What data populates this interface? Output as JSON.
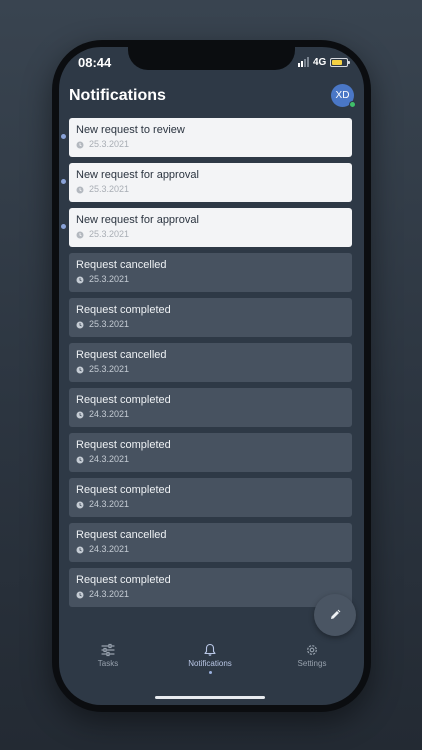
{
  "status_bar": {
    "time": "08:44",
    "network": "4G"
  },
  "header": {
    "title": "Notifications",
    "avatar_initials": "XD"
  },
  "notifications": [
    {
      "title": "New request to review",
      "date": "25.3.2021",
      "unread": true
    },
    {
      "title": "New request for approval",
      "date": "25.3.2021",
      "unread": true
    },
    {
      "title": "New request for approval",
      "date": "25.3.2021",
      "unread": true
    },
    {
      "title": "Request cancelled",
      "date": "25.3.2021",
      "unread": false
    },
    {
      "title": "Request completed",
      "date": "25.3.2021",
      "unread": false
    },
    {
      "title": "Request cancelled",
      "date": "25.3.2021",
      "unread": false
    },
    {
      "title": "Request completed",
      "date": "24.3.2021",
      "unread": false
    },
    {
      "title": "Request completed",
      "date": "24.3.2021",
      "unread": false
    },
    {
      "title": "Request completed",
      "date": "24.3.2021",
      "unread": false
    },
    {
      "title": "Request cancelled",
      "date": "24.3.2021",
      "unread": false
    },
    {
      "title": "Request completed",
      "date": "24.3.2021",
      "unread": false
    }
  ],
  "tabbar": {
    "tabs": [
      {
        "label": "Tasks",
        "icon": "sliders-icon",
        "active": false
      },
      {
        "label": "Notifications",
        "icon": "bell-icon",
        "active": true
      },
      {
        "label": "Settings",
        "icon": "gear-icon",
        "active": false
      }
    ]
  },
  "fab": {
    "icon": "pencil-icon"
  },
  "colors": {
    "screen_bg": "#2e3946",
    "unread_card": "#f3f4f6",
    "read_card": "#475260",
    "accent": "#4a77c6",
    "online": "#3fbf6a"
  }
}
